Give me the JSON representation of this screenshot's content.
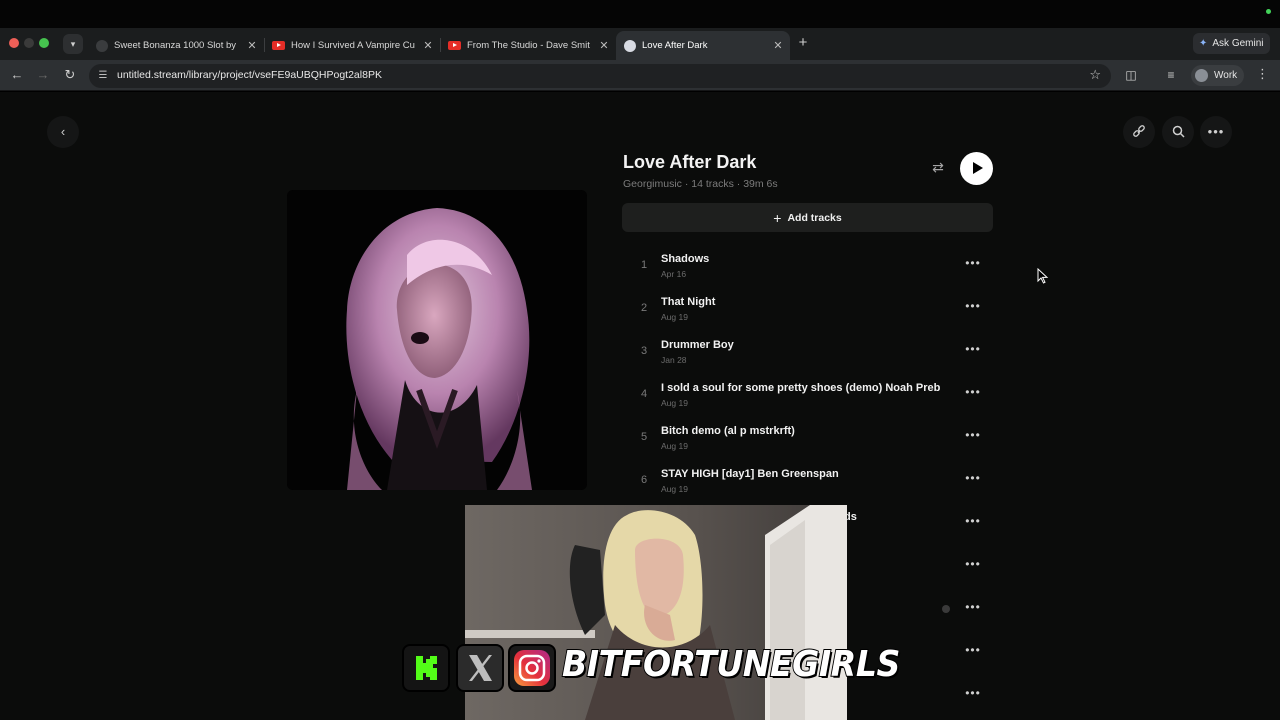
{
  "browser": {
    "tabs": [
      {
        "title": "Sweet Bonanza 1000 Slot by",
        "favicon": "generic-icon",
        "active": false
      },
      {
        "title": "How I Survived A Vampire Cu",
        "favicon": "youtube-icon",
        "active": false
      },
      {
        "title": "From The Studio - Dave Smit",
        "favicon": "youtube-icon",
        "active": false
      },
      {
        "title": "Love After Dark",
        "favicon": "page-icon",
        "active": true
      }
    ],
    "gemini_label": "Ask Gemini",
    "url": "untitled.stream/library/project/vseFE9aUBQHPogt2al8PK",
    "profile_label": "Work"
  },
  "project": {
    "title": "Love After Dark",
    "meta": "Georgimusic · 14 tracks · 39m 6s",
    "add_tracks_label": "Add tracks"
  },
  "tracks": [
    {
      "num": "1",
      "title": "Shadows",
      "date": "Apr 16"
    },
    {
      "num": "2",
      "title": "That Night",
      "date": "Aug 19"
    },
    {
      "num": "3",
      "title": "Drummer Boy",
      "date": "Jan 28"
    },
    {
      "num": "4",
      "title": "I sold a soul for some pretty shoes (demo) Noah Preb...",
      "date": "Aug 19"
    },
    {
      "num": "5",
      "title": "Bitch demo (al p mstrkrft)",
      "date": "Aug 19"
    },
    {
      "num": "6",
      "title": "STAY HIGH [day1] Ben Greenspan",
      "date": "Aug 19"
    },
    {
      "num": "",
      "title": "ds",
      "date": ""
    },
    {
      "num": "",
      "title": "",
      "date": ""
    },
    {
      "num": "",
      "title": "",
      "date": ""
    },
    {
      "num": "",
      "title": "",
      "date": ""
    },
    {
      "num": "",
      "title": "",
      "date": ""
    }
  ],
  "overlay": {
    "brand_text": "BITFORTUNEGIRLS",
    "logos": [
      "kick-icon",
      "x-icon",
      "instagram-icon"
    ]
  },
  "colors": {
    "page_bg": "#0b0c0b",
    "accent_play": "#ffffff",
    "tab_strip": "#1b1d1e"
  }
}
